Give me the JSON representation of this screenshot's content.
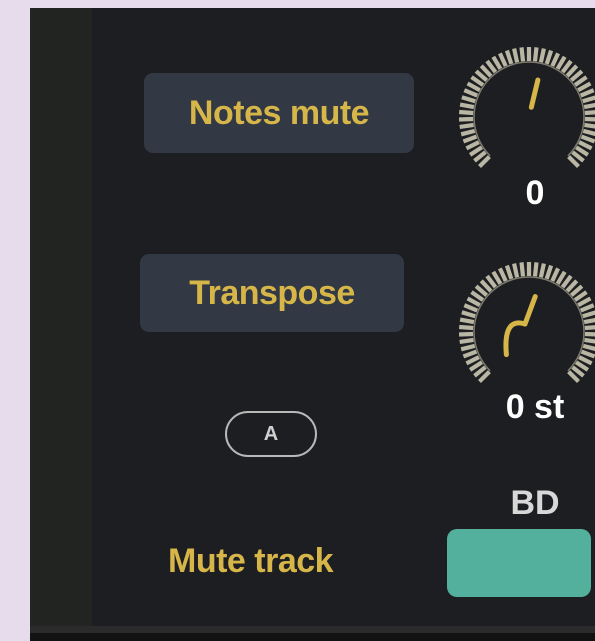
{
  "controls": {
    "notes_mute": {
      "label": "Notes mute",
      "value": "0",
      "knob_level": 0.55
    },
    "transpose": {
      "label": "Transpose",
      "value": "0 st",
      "knob_level": 0.5
    }
  },
  "badge": {
    "label": "A"
  },
  "track": {
    "name": "BD",
    "mute_label": "Mute track"
  },
  "colors": {
    "accent": "#d6b649",
    "button_bg": "#323844",
    "panel_bg": "#1d1e21",
    "mute_toggle": "#52b09c",
    "knob_ring": "#b9b6a4"
  }
}
